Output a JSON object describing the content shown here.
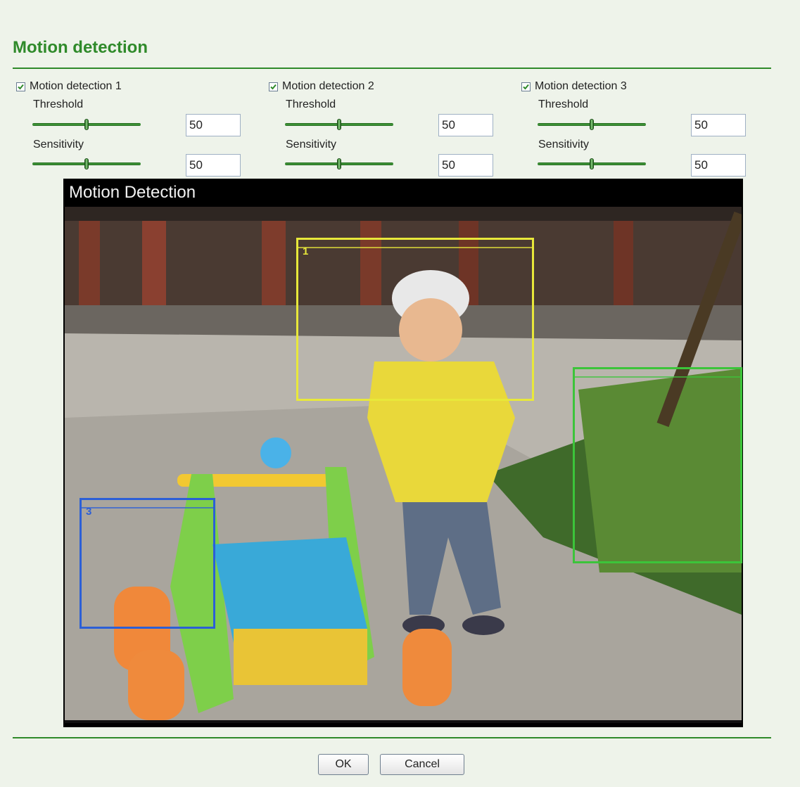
{
  "page": {
    "title": "Motion detection"
  },
  "groups": [
    {
      "checkbox_label": "Motion detection 1",
      "checked": true,
      "threshold_label": "Threshold",
      "threshold_value": "50",
      "sensitivity_label": "Sensitivity",
      "sensitivity_value": "50"
    },
    {
      "checkbox_label": "Motion detection 2",
      "checked": true,
      "threshold_label": "Threshold",
      "threshold_value": "50",
      "sensitivity_label": "Sensitivity",
      "sensitivity_value": "50"
    },
    {
      "checkbox_label": "Motion detection 3",
      "checked": true,
      "threshold_label": "Threshold",
      "threshold_value": "50",
      "sensitivity_label": "Sensitivity",
      "sensitivity_value": "50"
    }
  ],
  "video": {
    "title": "Motion Detection",
    "regions": [
      {
        "label": "1",
        "color": "#e8e83a"
      },
      {
        "label": "",
        "color": "#3cc43a"
      },
      {
        "label": "3",
        "color": "#2c5fd6"
      }
    ]
  },
  "buttons": {
    "ok": "OK",
    "cancel": "Cancel"
  }
}
